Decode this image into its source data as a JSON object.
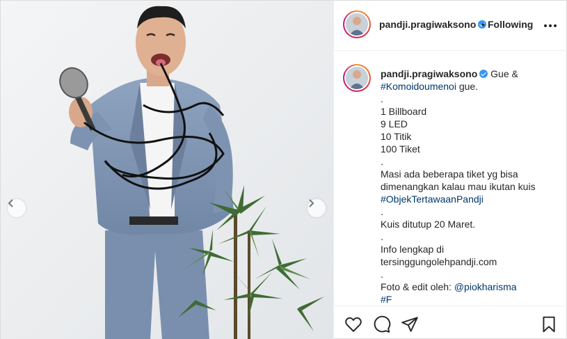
{
  "post": {
    "author": {
      "username": "pandji.pragiwaksono",
      "follow_separator": "•",
      "follow_status": "Following",
      "verified": true
    },
    "caption": {
      "username": "pandji.pragiwaksono",
      "text_start": "Gue &",
      "hashtag1": "#Komoidoumenoi",
      "text_after_hashtag1": "gue.",
      "lines": [
        ".",
        "1 Billboard",
        "9 LED",
        "10 Titik",
        "100 Tiket",
        ".",
        "Masi ada beberapa tiket yg bisa",
        "dimenangkan kalau mau ikutan kuis"
      ],
      "hashtag2": "#ObjekTertawaanPandji",
      "lines2": [
        ".",
        "Kuis ditutup 20 Maret.",
        ".",
        "Info lengkap di",
        "tersinggungolehpandji.com",
        "."
      ],
      "credit_prefix": "Foto & edit oleh:",
      "credit_mention": "@piokharisma",
      "truncated_line": "#F"
    },
    "icons": {
      "like": "heart-icon",
      "comment": "comment-icon",
      "share": "paper-plane-icon",
      "save": "bookmark-icon",
      "more": "more-dots-icon",
      "prev": "chevron-left-icon",
      "next": "chevron-right-icon"
    },
    "colors": {
      "link": "#00376b",
      "verified": "#3897f0",
      "text": "#262626",
      "border": "#dbdbdb"
    }
  }
}
